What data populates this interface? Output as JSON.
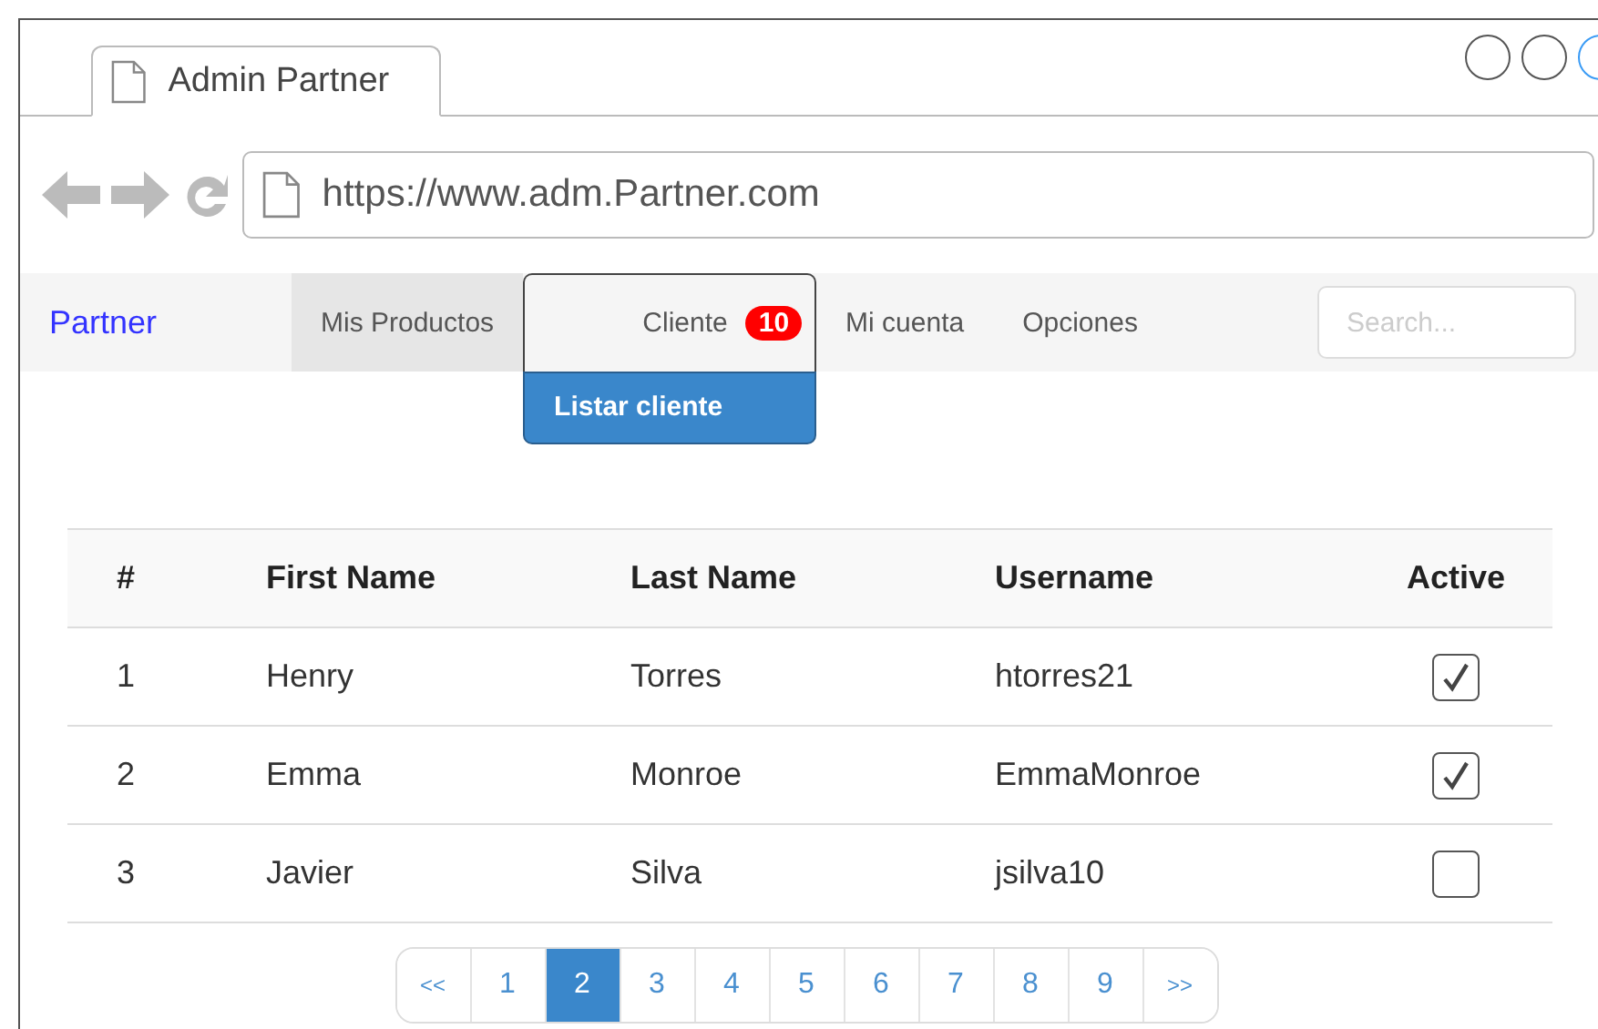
{
  "window": {
    "tab_title": "Admin Partner"
  },
  "address_bar": {
    "url": "https://www.adm.Partner.com"
  },
  "navbar": {
    "brand": "Partner",
    "items": [
      {
        "label": "Mis Productos",
        "selected": true,
        "expanded": false
      },
      {
        "label": "Cliente",
        "selected": false,
        "expanded": true,
        "badge": "10",
        "menu": [
          "Listar cliente"
        ]
      },
      {
        "label": "Mi cuenta",
        "selected": false,
        "expanded": false
      },
      {
        "label": "Opciones",
        "selected": false,
        "expanded": false
      }
    ],
    "search": {
      "placeholder": "Search..."
    }
  },
  "table": {
    "columns": [
      "#",
      "First Name",
      "Last Name",
      "Username",
      "Active"
    ],
    "rows": [
      {
        "cells": [
          "1",
          "Henry",
          "Torres",
          "htorres21"
        ],
        "active": true
      },
      {
        "cells": [
          "2",
          "Emma",
          "Monroe",
          "EmmaMonroe"
        ],
        "active": true
      },
      {
        "cells": [
          "3",
          "Javier",
          "Silva",
          "jsilva10"
        ],
        "active": false
      }
    ]
  },
  "pagination": {
    "first": "<<",
    "last": ">>",
    "pages": [
      {
        "label": "1",
        "selected": false
      },
      {
        "label": "2",
        "selected": true
      },
      {
        "label": "3",
        "selected": false
      },
      {
        "label": "4",
        "selected": false
      },
      {
        "label": "5",
        "selected": false
      },
      {
        "label": "6",
        "selected": false
      },
      {
        "label": "7",
        "selected": false
      },
      {
        "label": "8",
        "selected": false
      },
      {
        "label": "9",
        "selected": false
      }
    ]
  }
}
